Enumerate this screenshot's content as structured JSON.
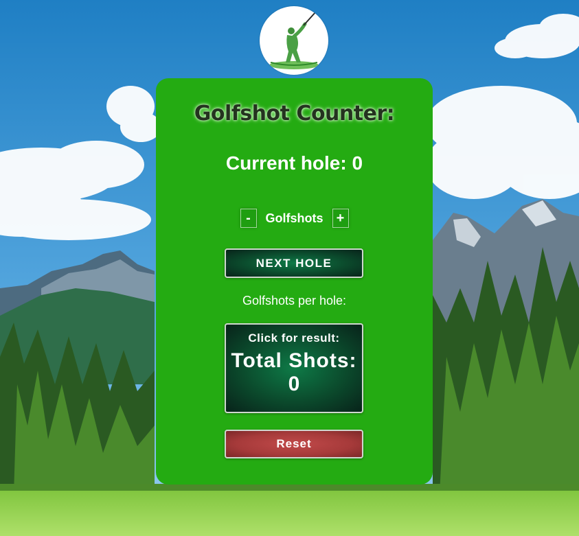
{
  "app": {
    "title": "Golfshot Counter:",
    "current_hole_label": "Current hole:",
    "current_hole_value": "0",
    "current_hole_text": "Current hole: 0"
  },
  "counter": {
    "decrement_label": "-",
    "label": "Golfshots",
    "increment_label": "+"
  },
  "buttons": {
    "next_hole": "NEXT HOLE",
    "reset": "Reset"
  },
  "per_hole_label": "Golfshots per hole:",
  "result": {
    "prompt": "Click for result:",
    "total_label": "Total Shots:",
    "total_value": "0"
  },
  "icons": {
    "logo": "golfer-logo-icon"
  },
  "colors": {
    "card": "#24ab12",
    "dark_button": "#0b4a2c",
    "reset_button": "#a63a3a",
    "title_text": "#24331f"
  }
}
